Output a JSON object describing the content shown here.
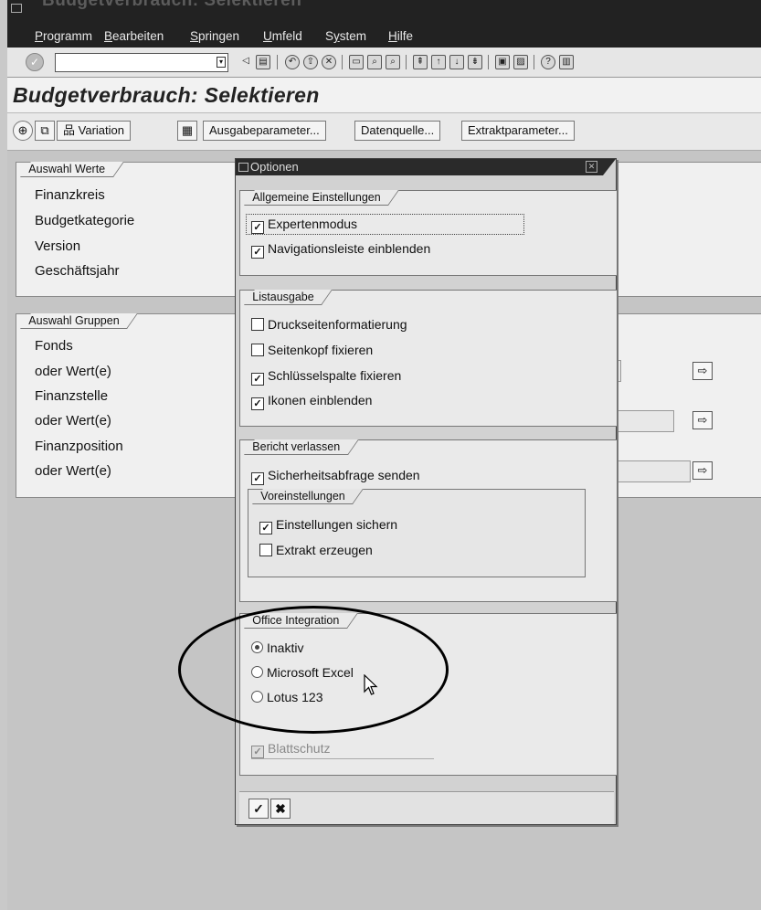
{
  "window": {
    "ghost_title": "Budgetverbrauch: Selektieren"
  },
  "menubar": {
    "items": [
      {
        "label": "Programm",
        "u": "P",
        "rest": "rogramm"
      },
      {
        "label": "Bearbeiten",
        "u": "B",
        "rest": "earbeiten"
      },
      {
        "label": "Springen",
        "u": "S",
        "rest": "pringen"
      },
      {
        "label": "Umfeld",
        "u": "U",
        "rest": "mfeld"
      },
      {
        "label": "System",
        "pre": "S",
        "u": "y",
        "rest": "stem"
      },
      {
        "label": "Hilfe",
        "u": "H",
        "rest": "ilfe"
      }
    ]
  },
  "toolbar": {
    "okcode_value": ""
  },
  "page": {
    "title": "Budgetverbrauch: Selektieren"
  },
  "appbar": {
    "variation_label": "Variation",
    "ausgabeparameter_label": "Ausgabeparameter...",
    "datenquelle_label": "Datenquelle...",
    "extraktparameter_label": "Extraktparameter..."
  },
  "auswahl_werte": {
    "title": "Auswahl Werte",
    "rows": [
      "Finanzkreis",
      "Budgetkategorie",
      "Version",
      "Geschäftsjahr"
    ]
  },
  "auswahl_gruppen": {
    "title": "Auswahl Gruppen",
    "rows": [
      "Fonds",
      "oder Wert(e)",
      "Finanzstelle",
      "oder Wert(e)",
      "Finanzposition",
      "oder Wert(e)"
    ]
  },
  "dialog": {
    "title": "Optionen",
    "allgemein": {
      "title": "Allgemeine Einstellungen",
      "expertenmodus": {
        "label": "Expertenmodus",
        "checked": true
      },
      "navigationsleiste": {
        "label": "Navigationsleiste einblenden",
        "checked": true
      }
    },
    "listausgabe": {
      "title": "Listausgabe",
      "druckseiten": {
        "label": "Druckseitenformatierung",
        "checked": false
      },
      "seitenkopf": {
        "label": "Seitenkopf fixieren",
        "checked": false
      },
      "schluesselspalte": {
        "label": "Schlüsselspalte fixieren",
        "checked": true
      },
      "ikonen": {
        "label": "Ikonen einblenden",
        "checked": true
      }
    },
    "bericht": {
      "title": "Bericht verlassen",
      "sicherheitsabfrage": {
        "label": "Sicherheitsabfrage senden",
        "checked": true
      },
      "voreinstellungen": {
        "title": "Voreinstellungen",
        "einstellungen_sichern": {
          "label": "Einstellungen sichern",
          "checked": true
        },
        "extrakt_erzeugen": {
          "label": "Extrakt erzeugen",
          "checked": false
        }
      }
    },
    "office": {
      "title": "Office Integration",
      "inaktiv": {
        "label": "Inaktiv",
        "selected": true
      },
      "excel": {
        "label": "Microsoft Excel",
        "selected": false
      },
      "lotus": {
        "label": "Lotus 123",
        "selected": false
      },
      "blattschutz": {
        "label": "Blattschutz",
        "checked": true,
        "disabled": true
      }
    }
  },
  "colors": {
    "menubar_bg": "#222222",
    "annotation": "#000000"
  }
}
